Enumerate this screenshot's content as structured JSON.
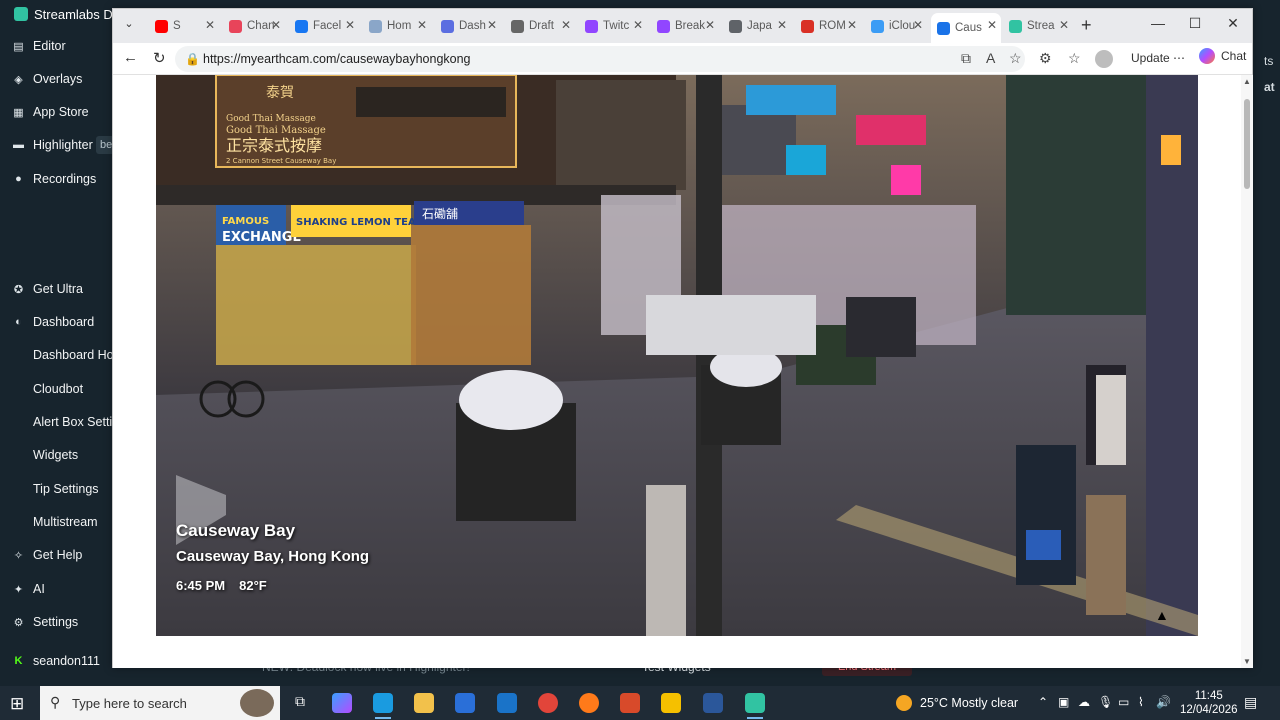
{
  "streamlabs": {
    "title": "Streamlabs De",
    "nav": [
      {
        "label": "Editor",
        "icon": "editor-icon"
      },
      {
        "label": "Overlays",
        "icon": "overlays-icon"
      },
      {
        "label": "App Store",
        "icon": "store-icon"
      },
      {
        "label": "Highlighter",
        "icon": "highlighter-icon",
        "badge": "be"
      },
      {
        "label": "Recordings",
        "icon": "recordings-icon"
      }
    ],
    "nav2": [
      {
        "label": "Get Ultra",
        "icon": "ultra-icon"
      },
      {
        "label": "Dashboard",
        "icon": "dashboard-icon"
      }
    ],
    "sub": [
      "Dashboard Hor",
      "Cloudbot",
      "Alert Box Settir",
      "Widgets",
      "Tip Settings",
      "Multistream"
    ],
    "nav3": [
      {
        "label": "Get Help",
        "icon": "help-icon"
      },
      {
        "label": "AI",
        "icon": "ai-icon"
      },
      {
        "label": "Settings",
        "icon": "settings-icon"
      },
      {
        "label": "seandon111",
        "icon": "kick-icon"
      }
    ],
    "right_text": "ts",
    "right_text2": "at",
    "bottom": {
      "news": "NEW: Deadlock now live in Highlighter!",
      "test_widgets": "Test Widgets",
      "end_stream": "End Stream"
    }
  },
  "browser": {
    "tabs": [
      {
        "label": "S",
        "color": "#ff0000"
      },
      {
        "label": "Chan",
        "color": "#e8445a"
      },
      {
        "label": "Facel",
        "color": "#1877f2"
      },
      {
        "label": "Hom",
        "color": "#8aa6c8"
      },
      {
        "label": "Dash",
        "color": "#5b6ee1"
      },
      {
        "label": "Draft",
        "color": "#666666"
      },
      {
        "label": "Twitc",
        "color": "#9146ff"
      },
      {
        "label": "Break",
        "color": "#9146ff"
      },
      {
        "label": "Japa",
        "color": "#5f6368"
      },
      {
        "label": "ROM",
        "color": "#d93025"
      },
      {
        "label": "iClou",
        "color": "#3b9cf5"
      },
      {
        "label": "Caus",
        "color": "#1a73e8",
        "active": true
      },
      {
        "label": "Strea",
        "color": "#31c3a2"
      }
    ],
    "url": "https://myearthcam.com/causewaybayhongkong",
    "update_label": "Update",
    "chat_label": "Chat"
  },
  "cam": {
    "title": "Causeway Bay",
    "location": "Causeway Bay, Hong Kong",
    "time": "6:45 PM",
    "temp": "82°F",
    "signs": {
      "massage_top": "泰賀",
      "massage_en": "Good Thai Massage",
      "massage_en2": "Good Thai Massage",
      "massage_cn": "正宗泰式按摩",
      "massage_addr": "2 Cannon Street Causeway Bay",
      "exchange_top": "FAMOUS",
      "exchange": "EXCHANGE",
      "lemon": "SHAKING LEMON TEA",
      "shop": "石磡舖"
    }
  },
  "taskbar": {
    "search_placeholder": "Type here to search",
    "weather": "25°C  Mostly clear",
    "time": "11:45",
    "date": "12/04/2026"
  }
}
